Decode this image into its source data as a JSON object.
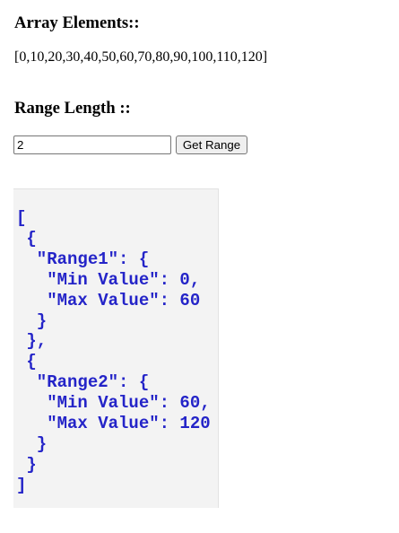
{
  "array_section": {
    "heading": "Array Elements::",
    "values_text": "[0,10,20,30,40,50,60,70,80,90,100,110,120]"
  },
  "range_section": {
    "heading": "Range Length ::",
    "input_value": "2",
    "button_label": "Get Range"
  },
  "output": {
    "json_text": "[\n {\n  \"Range1\": {\n   \"Min Value\": 0,\n   \"Max Value\": 60\n  }\n },\n {\n  \"Range2\": {\n   \"Min Value\": 60,\n   \"Max Value\": 120\n  }\n }\n]"
  },
  "colors": {
    "json_text": "#2424c8",
    "output_background": "#f3f3f3"
  }
}
